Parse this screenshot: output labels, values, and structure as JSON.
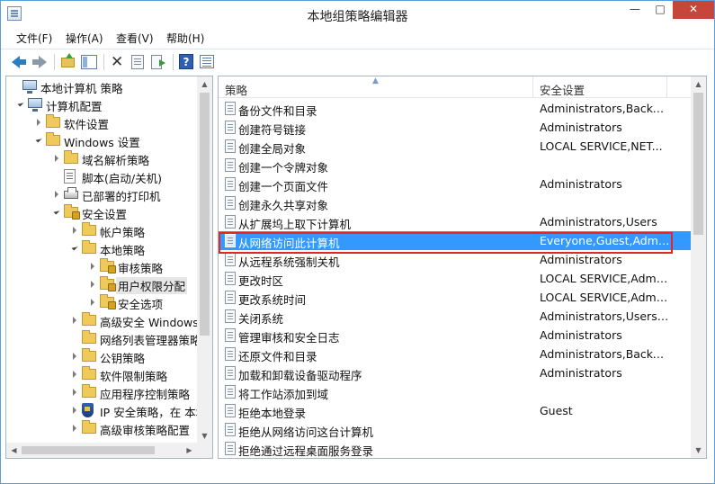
{
  "window": {
    "title": "本地组策略编辑器",
    "minimize_glyph": "—",
    "maximize_glyph": "□",
    "close_glyph": "✕"
  },
  "menu": {
    "items": [
      "文件(F)",
      "操作(A)",
      "查看(V)",
      "帮助(H)"
    ]
  },
  "tree": {
    "items": [
      {
        "label": "本地计算机 策略",
        "icon": "computer-policy-icon",
        "expander": "none"
      },
      {
        "label": "计算机配置",
        "icon": "computer-icon",
        "expander": "open"
      },
      {
        "label": "软件设置",
        "icon": "folder-icon",
        "expander": "closed"
      },
      {
        "label": "Windows 设置",
        "icon": "folder-icon",
        "expander": "open"
      },
      {
        "label": "域名解析策略",
        "icon": "folder-icon",
        "expander": "closed"
      },
      {
        "label": "脚本(启动/关机)",
        "icon": "script-icon",
        "expander": "none"
      },
      {
        "label": "已部署的打印机",
        "icon": "printer-icon",
        "expander": "closed"
      },
      {
        "label": "安全设置",
        "icon": "security-folder-icon",
        "expander": "open"
      },
      {
        "label": "帐户策略",
        "icon": "folder-icon",
        "expander": "closed"
      },
      {
        "label": "本地策略",
        "icon": "folder-icon",
        "expander": "open"
      },
      {
        "label": "审核策略",
        "icon": "policy-folder-icon",
        "expander": "closed"
      },
      {
        "label": "用户权限分配",
        "icon": "policy-folder-icon",
        "expander": "closed",
        "selected": true
      },
      {
        "label": "安全选项",
        "icon": "policy-folder-icon",
        "expander": "closed"
      },
      {
        "label": "高级安全 Windows",
        "icon": "folder-icon",
        "expander": "closed"
      },
      {
        "label": "网络列表管理器策略",
        "icon": "folder-icon",
        "expander": "none"
      },
      {
        "label": "公钥策略",
        "icon": "folder-icon",
        "expander": "closed"
      },
      {
        "label": "软件限制策略",
        "icon": "folder-icon",
        "expander": "closed"
      },
      {
        "label": "应用程序控制策略",
        "icon": "folder-icon",
        "expander": "closed"
      },
      {
        "label": "IP 安全策略，在 本地",
        "icon": "shield-icon",
        "expander": "closed"
      },
      {
        "label": "高级审核策略配置",
        "icon": "folder-icon",
        "expander": "closed"
      }
    ]
  },
  "list": {
    "headers": {
      "policy": "策略",
      "setting": "安全设置"
    },
    "rows": [
      {
        "policy": "备份文件和目录",
        "setting": "Administrators,Backu..."
      },
      {
        "policy": "创建符号链接",
        "setting": "Administrators"
      },
      {
        "policy": "创建全局对象",
        "setting": "LOCAL SERVICE,NET..."
      },
      {
        "policy": "创建一个令牌对象",
        "setting": ""
      },
      {
        "policy": "创建一个页面文件",
        "setting": "Administrators"
      },
      {
        "policy": "创建永久共享对象",
        "setting": ""
      },
      {
        "policy": "从扩展坞上取下计算机",
        "setting": "Administrators,Users"
      },
      {
        "policy": "从网络访问此计算机",
        "setting": "Everyone,Guest,Admin...",
        "selected": true
      },
      {
        "policy": "从远程系统强制关机",
        "setting": "Administrators"
      },
      {
        "policy": "更改时区",
        "setting": "LOCAL SERVICE,Admi..."
      },
      {
        "policy": "更改系统时间",
        "setting": "LOCAL SERVICE,Admi..."
      },
      {
        "policy": "关闭系统",
        "setting": "Administrators,Users,..."
      },
      {
        "policy": "管理审核和安全日志",
        "setting": "Administrators"
      },
      {
        "policy": "还原文件和目录",
        "setting": "Administrators,Backu..."
      },
      {
        "policy": "加载和卸载设备驱动程序",
        "setting": "Administrators"
      },
      {
        "policy": "将工作站添加到域",
        "setting": ""
      },
      {
        "policy": "拒绝本地登录",
        "setting": "Guest"
      },
      {
        "policy": "拒绝从网络访问这台计算机",
        "setting": ""
      },
      {
        "policy": "拒绝通过远程桌面服务登录",
        "setting": ""
      }
    ]
  },
  "colors": {
    "selection": "#3399ff",
    "highlight_border": "#e02828",
    "close_button": "#c7463b"
  }
}
